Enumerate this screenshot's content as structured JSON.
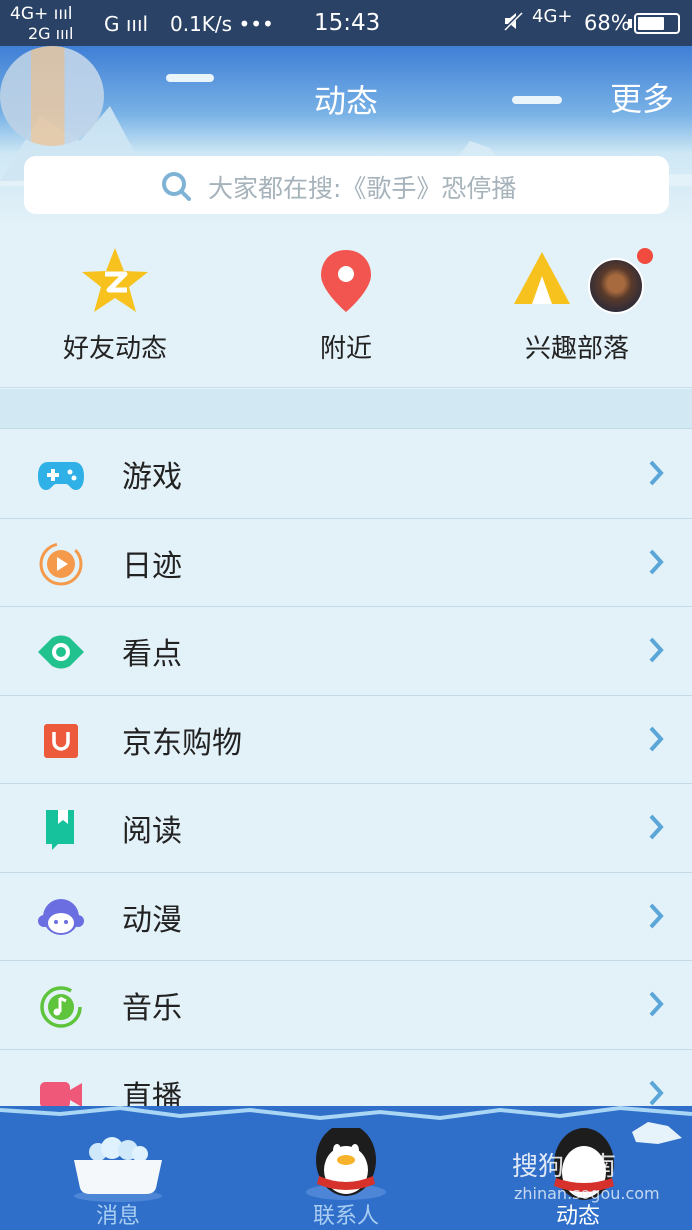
{
  "status_bar": {
    "network1": "4G+ ıııl",
    "network2": "2G ıııl",
    "g_signal": "G ıııl",
    "speed": "0.1K/s •••",
    "time": "15:43",
    "network_right": "4G+",
    "battery": "68%",
    "battery_level": 0.68,
    "mute_icon": "mute-icon"
  },
  "header": {
    "title": "动态",
    "more": "更多",
    "search_placeholder": "大家都在搜:《歌手》恐停播"
  },
  "quick": [
    {
      "label": "好友动态",
      "icon": "friend-feed-star-icon"
    },
    {
      "label": "附近",
      "icon": "location-pin-icon"
    },
    {
      "label": "兴趣部落",
      "icon": "tribe-tent-icon"
    }
  ],
  "menu": [
    {
      "label": "游戏",
      "icon": "gamepad-icon"
    },
    {
      "label": "日迹",
      "icon": "daily-trace-icon"
    },
    {
      "label": "看点",
      "icon": "eye-icon"
    },
    {
      "label": "京东购物",
      "icon": "jd-shopping-icon"
    },
    {
      "label": "阅读",
      "icon": "book-icon"
    },
    {
      "label": "动漫",
      "icon": "anime-icon"
    },
    {
      "label": "音乐",
      "icon": "music-icon"
    },
    {
      "label": "直播",
      "icon": "live-camera-icon"
    }
  ],
  "tabs": [
    {
      "label": "消息",
      "icon": "bathtub-icon"
    },
    {
      "label": "联系人",
      "icon": "penguin-icon"
    },
    {
      "label": "动态",
      "icon": "penguin-hearts-icon",
      "active": true
    }
  ],
  "watermark": {
    "text": "搜狗指南",
    "url": "zhinan.sogou.com"
  },
  "colors": {
    "header_blue": "#3f7fd6",
    "tab_blue": "#2f6fc9",
    "chevron": "#5aa6d8",
    "badge_red": "#f04b3e"
  }
}
